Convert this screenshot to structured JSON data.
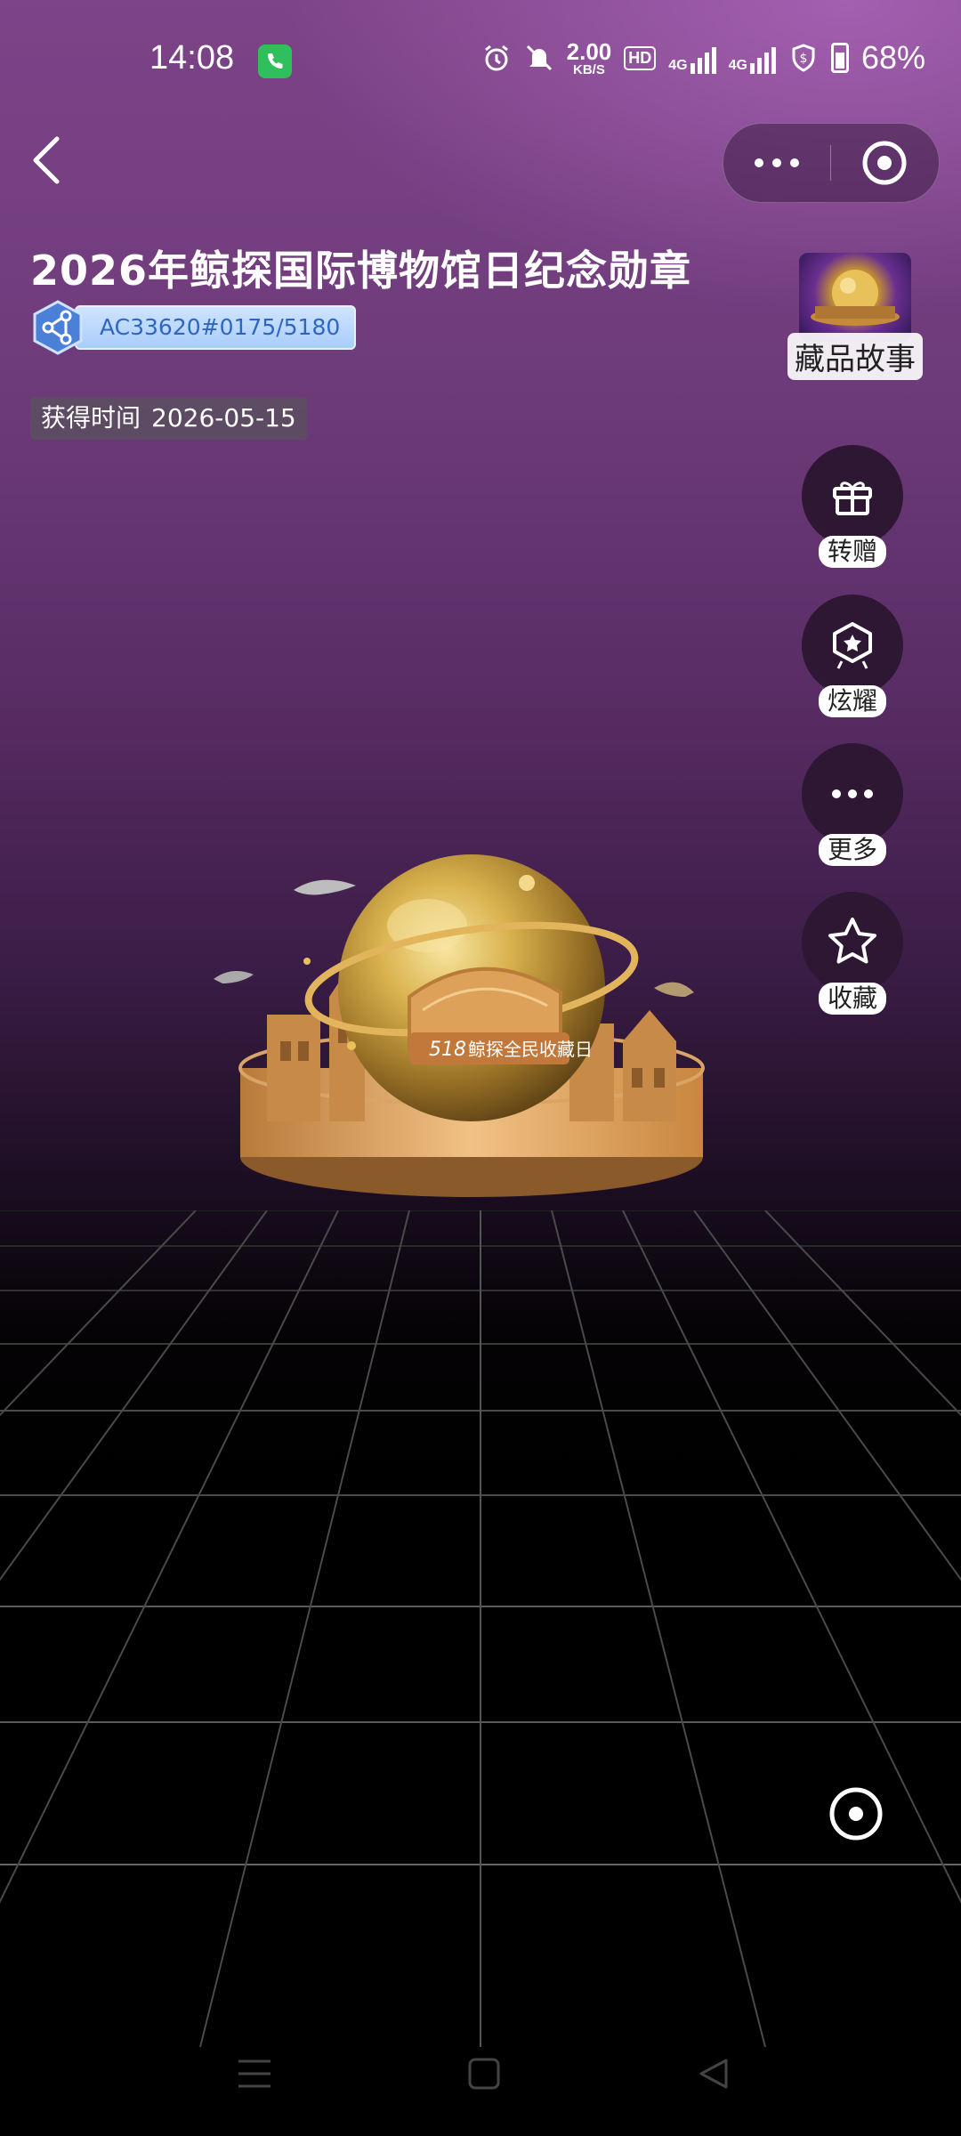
{
  "status_bar": {
    "time": "14:08",
    "net_speed_value": "2.00",
    "net_speed_unit": "KB/S",
    "hd_badge": "HD",
    "signal_1_type": "4G",
    "signal_2_type": "4G",
    "battery": "68%",
    "icons": [
      "phone-call-icon",
      "alarm-icon",
      "mute-icon",
      "shield-dollar-icon",
      "battery-icon"
    ]
  },
  "mini_program_capsule": {
    "more_icon": "more-dots-icon",
    "close_icon": "target-close-icon"
  },
  "item": {
    "title": "2026年鲸探国际博物馆日纪念勋章",
    "chain_code": "AC33620#0175/5180",
    "obtain_label": "获得时间",
    "obtain_date": "2026-05-15"
  },
  "side": {
    "story_label": "藏品故事",
    "actions": [
      {
        "label": "转赠",
        "icon": "gift-icon"
      },
      {
        "label": "炫耀",
        "icon": "badge-star-icon"
      },
      {
        "label": "更多",
        "icon": "more-dots-icon"
      },
      {
        "label": "收藏",
        "icon": "star-icon"
      }
    ]
  },
  "model": {
    "banner_text": "鲸探全民收藏日",
    "banner_number": "518"
  },
  "colors": {
    "accent_purple": "#7d4488",
    "gold": "#d9a441",
    "chain_blue": "#2f66c4"
  }
}
